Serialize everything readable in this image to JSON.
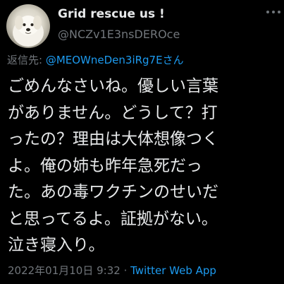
{
  "tweet": {
    "display_name": "Grid rescue us !",
    "handle": "@NCZv1E3nsDEROce",
    "reply_prefix": "返信先: ",
    "reply_target": "@MEOWneDen3iRg7Eさん",
    "lines": [
      "ごめんなさいね。優しい言葉",
      "がありません。どうして？打",
      "ったの？理由は大体想像つく",
      "よ。俺の姉も昨年急死だっ",
      "た。あの毒ワクチンのせいだ",
      "と思ってるよ。証拠がない。",
      "泣き寝入り。"
    ],
    "timestamp": "2022年01月10日 9:32",
    "separator": " · ",
    "source": "Twitter Web App"
  },
  "colors": {
    "background": "#000000",
    "text": "#e7e9ea",
    "secondary": "#71767b",
    "link": "#1d9bf0"
  },
  "icons": {
    "avatar": "white-dog-photo",
    "more": "more-options-icon"
  }
}
